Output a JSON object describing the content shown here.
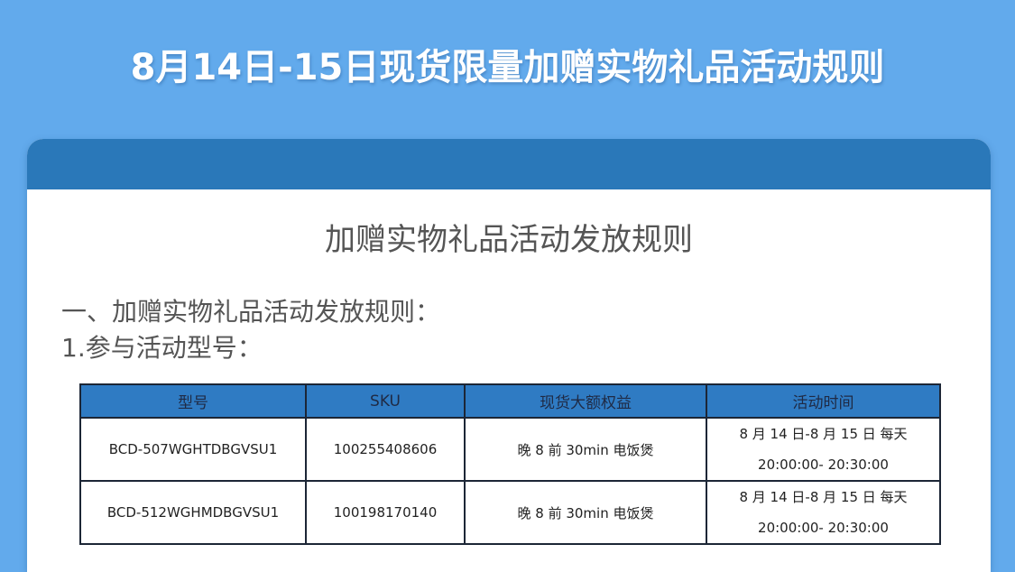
{
  "page": {
    "title": "8月14日-15日现货限量加赠实物礼品活动规则"
  },
  "card": {
    "title": "加赠实物礼品活动发放规则",
    "section_heading": "一、加赠实物礼品活动发放规则：",
    "subheading": "1.参与活动型号："
  },
  "table": {
    "headers": [
      "型号",
      "SKU",
      "现货大额权益",
      "活动时间"
    ],
    "rows": [
      {
        "model": "BCD-507WGHTDBGVSU1",
        "sku": "100255408606",
        "benefit": "晚 8 前 30min 电饭煲",
        "time_line1": "8 月 14 日-8 月 15 日  每天",
        "time_line2": "20:00:00- 20:30:00"
      },
      {
        "model": "BCD-512WGHMDBGVSU1",
        "sku": "100198170140",
        "benefit": "晚 8 前 30min 电饭煲",
        "time_line1": "8 月 14 日-8 月 15 日  每天",
        "time_line2": "20:00:00- 20:30:00"
      }
    ]
  },
  "colors": {
    "background": "#62aaec",
    "card_header": "#2a78b9",
    "table_header": "#2f7bc3"
  }
}
